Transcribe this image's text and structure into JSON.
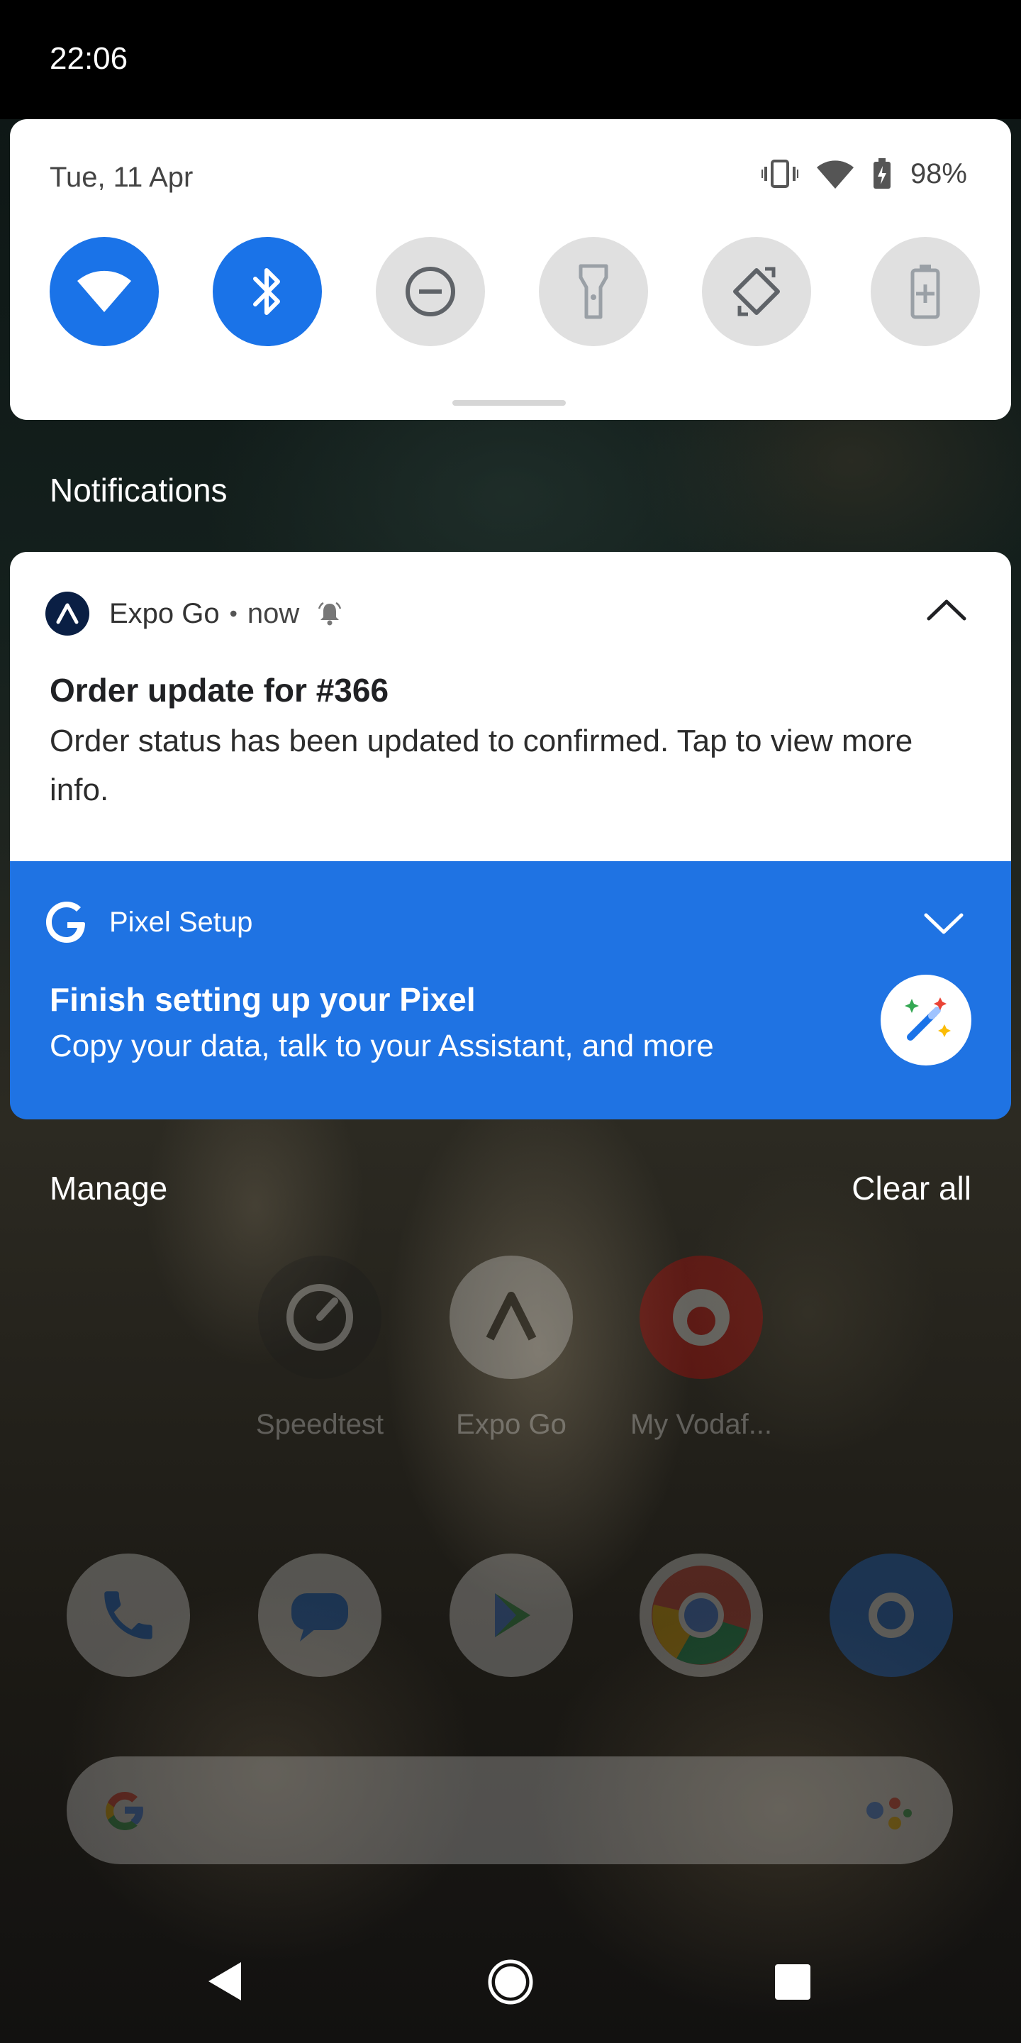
{
  "status_bar": {
    "time": "22:06"
  },
  "quick_settings": {
    "date": "Tue, 11 Apr",
    "battery_percent": "98%",
    "tiles": [
      {
        "name": "wifi",
        "state": "on"
      },
      {
        "name": "bluetooth",
        "state": "on"
      },
      {
        "name": "do-not-disturb",
        "state": "off"
      },
      {
        "name": "flashlight",
        "state": "off"
      },
      {
        "name": "auto-rotate",
        "state": "off"
      },
      {
        "name": "battery-saver",
        "state": "off"
      }
    ]
  },
  "notifications_header": "Notifications",
  "notifications": {
    "expo": {
      "app": "Expo Go",
      "separator": "•",
      "time": "now",
      "title": "Order update for #366",
      "body": "Order status has been updated to confirmed. Tap to view more info."
    },
    "pixel_setup": {
      "app": "Pixel Setup",
      "title": "Finish setting up your Pixel",
      "body": "Copy your data, talk to your Assistant, and more"
    }
  },
  "actions": {
    "manage": "Manage",
    "clear_all": "Clear all"
  },
  "home": {
    "apps": [
      "Speedtest",
      "Expo Go",
      "My Vodaf..."
    ]
  },
  "colors": {
    "accent": "#1a73e8",
    "pixel_bg": "#1f73e3",
    "tile_off": "#e0e0e0"
  }
}
